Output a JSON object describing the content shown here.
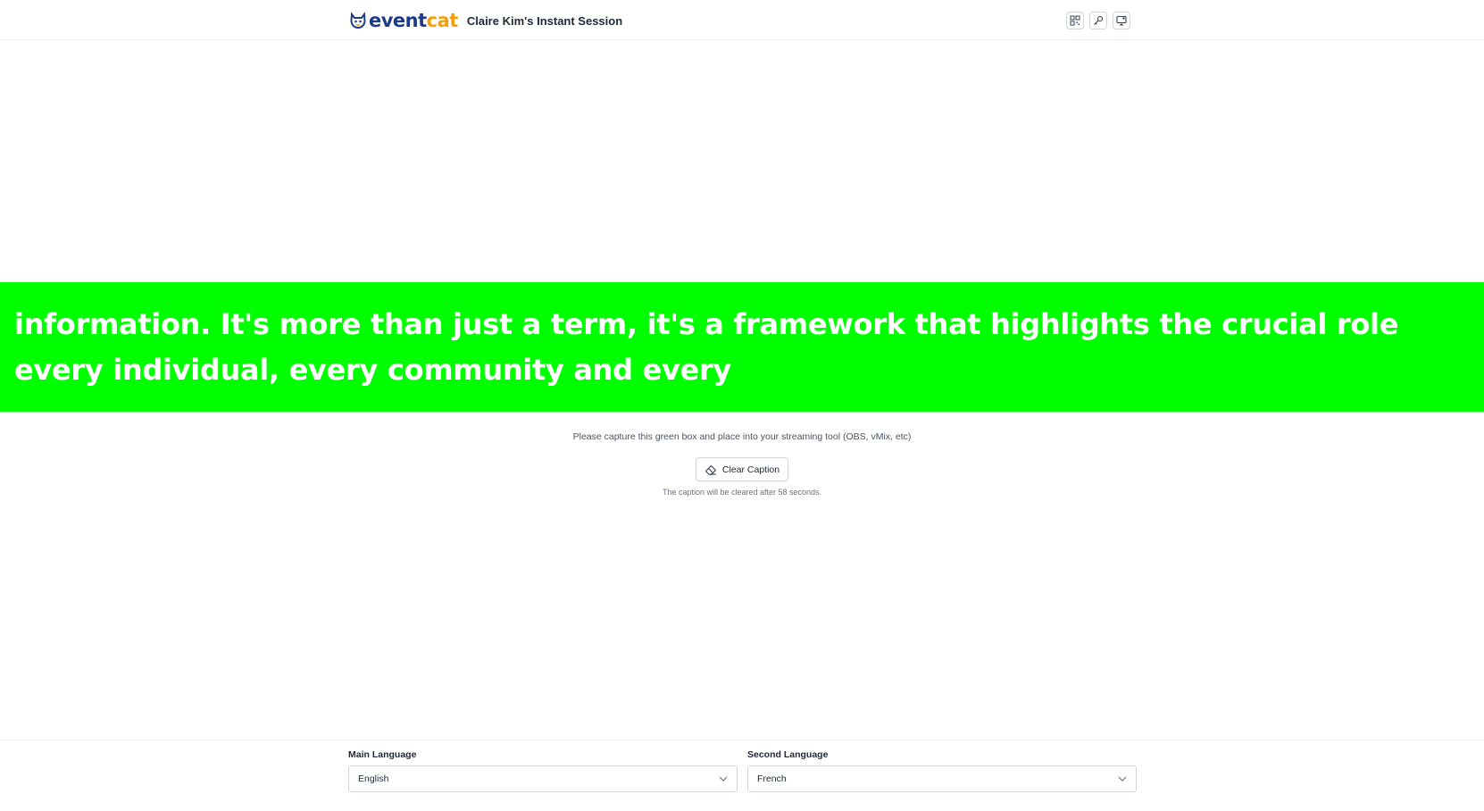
{
  "header": {
    "logo_text_event": "event",
    "logo_text_cat": "cat",
    "session_title": "Claire Kim's Instant Session",
    "actions": [
      {
        "name": "qr-code-icon"
      },
      {
        "name": "key-icon"
      },
      {
        "name": "monitor-icon"
      }
    ]
  },
  "caption": {
    "text": "information. It's more than just a term, it's a framework that highlights the crucial role every individual, every community and every",
    "background_color": "#00ff00",
    "text_color": "#ffffff"
  },
  "main": {
    "instruction": "Please capture this green box and place into your streaming tool (OBS, vMix, etc)",
    "clear_button_label": "Clear Caption",
    "clear_button_icon": "eraser-icon",
    "clear_note": "The caption will be cleared after 58 seconds."
  },
  "footer": {
    "main_language": {
      "label": "Main Language",
      "value": "English"
    },
    "second_language": {
      "label": "Second Language",
      "value": "French"
    }
  },
  "colors": {
    "brand_primary": "#1e3a8a",
    "brand_accent": "#f59e0b",
    "caption_green": "#00ff00"
  }
}
